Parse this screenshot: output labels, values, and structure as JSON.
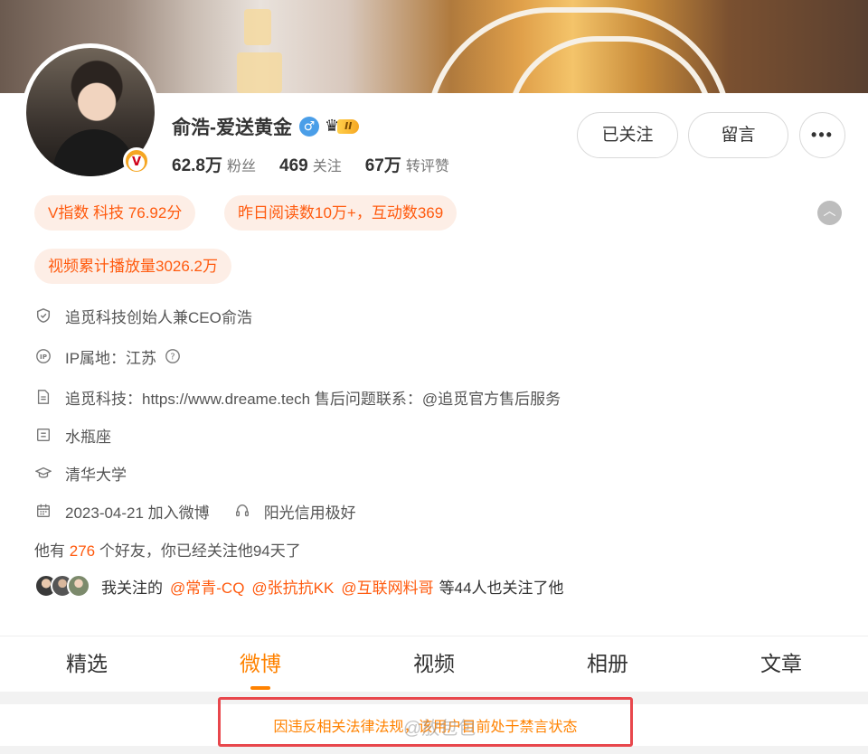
{
  "profile": {
    "name": "俞浩-爱送黄金",
    "gender_symbol": "♂",
    "level_badge": "II",
    "vip_badge": "V",
    "stats": [
      {
        "value": "62.8万",
        "label": "粉丝"
      },
      {
        "value": "469",
        "label": "关注"
      },
      {
        "value": "67万",
        "label": "转评赞"
      }
    ]
  },
  "actions": {
    "follow_label": "已关注",
    "message_label": "留言",
    "more_label": "•••"
  },
  "tags": {
    "v_index": "V指数 科技 76.92分",
    "reads": "昨日阅读数10万+，互动数369",
    "video_plays": "视频累计播放量3026.2万"
  },
  "info": {
    "verification": "追觅科技创始人兼CEO俞浩",
    "ip_location": "IP属地：江苏",
    "bio": "追觅科技：https://www.dreame.tech 售后问题联系：@追觅官方售后服务",
    "zodiac": "水瓶座",
    "school": "清华大学",
    "joined": "2023-04-21 加入微博",
    "credit": "阳光信用极好"
  },
  "friends": {
    "prefix": "他有 ",
    "count": "276",
    "suffix": " 个好友，你已经关注他94天了"
  },
  "mutual": {
    "prefix": "我关注的",
    "users": [
      "@常青-CQ",
      "@张抗抗KK",
      "@互联网料哥"
    ],
    "suffix": "等44人也关注了他"
  },
  "tabs": [
    {
      "label": "精选",
      "active": false
    },
    {
      "label": "微博",
      "active": true
    },
    {
      "label": "视频",
      "active": false
    },
    {
      "label": "相册",
      "active": false
    },
    {
      "label": "文章",
      "active": false
    }
  ],
  "notice": "因违反相关法律法规，该用户目前处于禁言状态",
  "watermark": "@放包包",
  "colors": {
    "accent": "#ff8200",
    "tag_text": "#ff5a0e",
    "tag_bg": "#fdeee6",
    "notice_border": "#e8474c"
  }
}
